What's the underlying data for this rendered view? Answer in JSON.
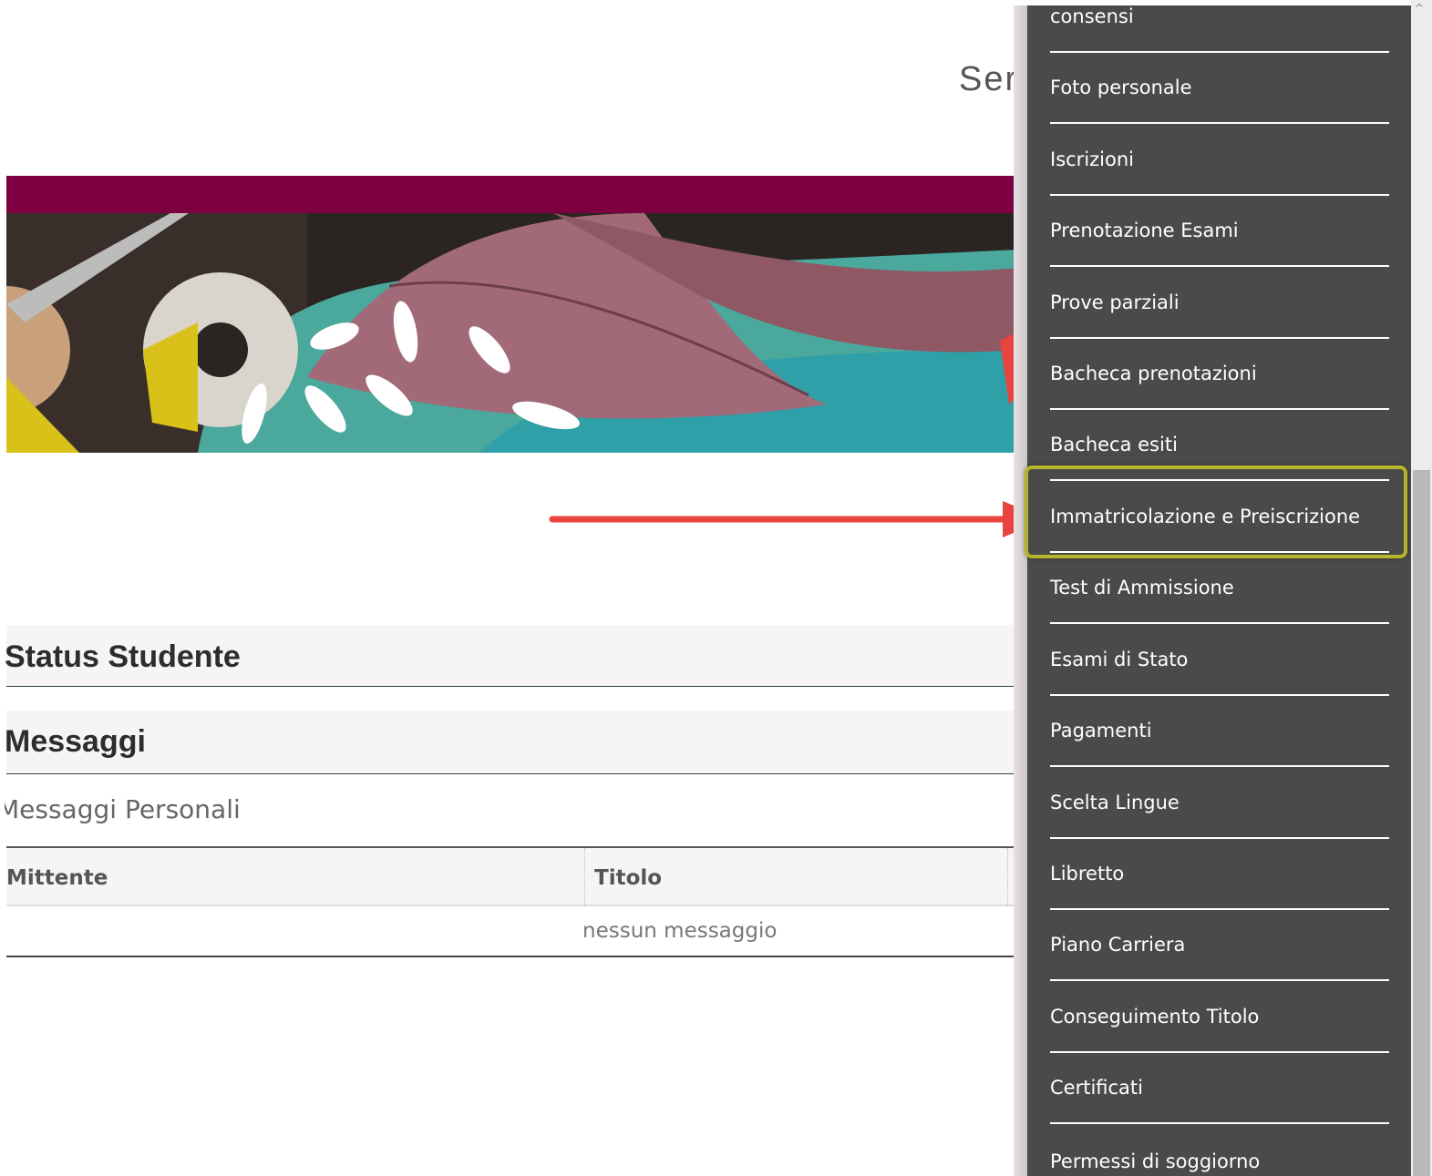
{
  "header": {
    "page_heading": "Ser"
  },
  "sections": {
    "status_title": "Status Studente",
    "messages_title": "Messaggi",
    "personal_messages_title": "Messaggi Personali"
  },
  "messages_table": {
    "columns": [
      "Mittente",
      "Titolo"
    ],
    "empty_text": "nessun messaggio"
  },
  "drawer_menu": {
    "items": [
      {
        "label": "consensi"
      },
      {
        "label": "Foto personale"
      },
      {
        "label": "Iscrizioni"
      },
      {
        "label": "Prenotazione Esami"
      },
      {
        "label": "Prove parziali"
      },
      {
        "label": "Bacheca prenotazioni"
      },
      {
        "label": "Bacheca esiti"
      },
      {
        "label": "Immatricolazione e Preiscrizione",
        "highlighted": true
      },
      {
        "label": "Test di Ammissione"
      },
      {
        "label": "Esami di Stato"
      },
      {
        "label": "Pagamenti"
      },
      {
        "label": "Scelta Lingue"
      },
      {
        "label": "Libretto"
      },
      {
        "label": "Piano Carriera"
      },
      {
        "label": "Conseguimento Titolo"
      },
      {
        "label": "Certificati"
      },
      {
        "label": "Permessi di soggiorno"
      }
    ]
  },
  "colors": {
    "brand_stripe": "#7d0040",
    "drawer_bg": "#4a4a4a",
    "highlight_border": "#b5b52a",
    "annotation_arrow": "#e8443f"
  }
}
